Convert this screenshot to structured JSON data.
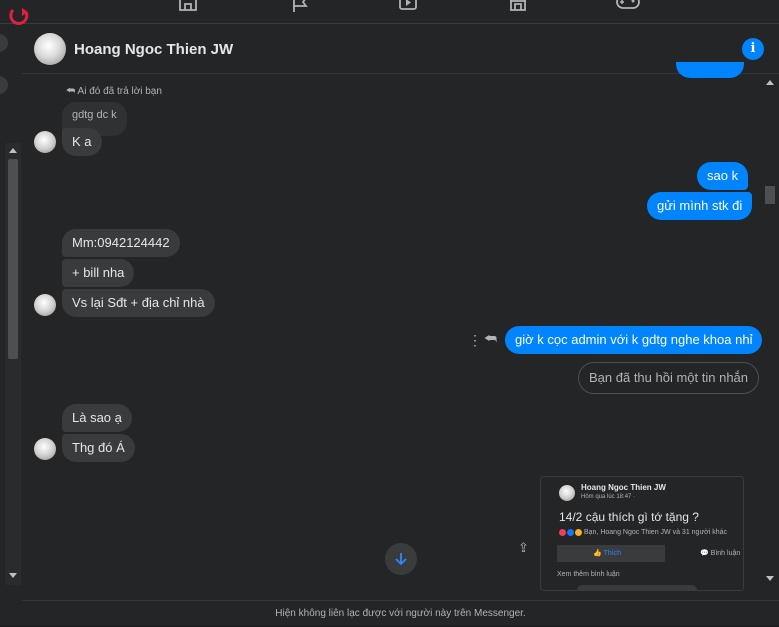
{
  "contact": {
    "name": "Hoang Ngoc Thien JW"
  },
  "reply_indicator": "Ai đó đã trả lời bạn",
  "messages": {
    "replied_quote": "gdtg dc k",
    "m1": "K a",
    "m2": "sao k",
    "m3": "gửi mình stk đi",
    "m4": "Mm:0942124442",
    "m5": "+ bill nha",
    "m6": "Vs lại Sđt + địa chỉ nhà",
    "m7": "giờ k cọc admin với k gdtg nghe khoa nhỉ",
    "m8": "Bạn đã thu hồi một tin nhắn",
    "m9": "Là sao ạ",
    "m10": "Thg đó Á"
  },
  "shared_post": {
    "author": "Hoang Ngoc Thien JW",
    "time": "Hôm qua lúc 18:47 ·",
    "text": "14/2 cậu thích gì tớ tặng ?",
    "reactions": "Bạn, Hoang Ngoc Thien JW và 31 người khác",
    "like_label": "Thích",
    "comment_label": "Bình luận",
    "more_comments": "Xem thêm bình luận"
  },
  "footer_text": "Hiện không liên lạc được với người này trên Messenger.",
  "colors": {
    "accent": "#0084ff",
    "incoming": "#3a3b3c",
    "background": "#242526"
  }
}
